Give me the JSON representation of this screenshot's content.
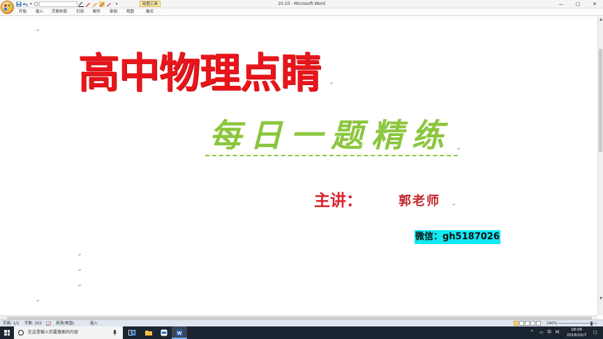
{
  "window": {
    "title": "10.10 - Microsoft Word",
    "contextual_tab": "绘图工具",
    "controls": {
      "minimize": "—",
      "restore": "▢",
      "close": "✕"
    }
  },
  "quick_access": {
    "undo_arrow": "▾",
    "customize": "▾"
  },
  "ribbon": {
    "tabs": [
      "开始",
      "插入",
      "页面布局",
      "引用",
      "邮件",
      "审阅",
      "视图",
      "格式"
    ]
  },
  "document": {
    "main_title": "高中物理点睛",
    "subtitle": "每日一题精练",
    "lecturer_label": "主讲：",
    "lecturer_name": "郭老师",
    "wechat": "微信：gh5187026",
    "paragraph_mark": "↵"
  },
  "status_bar": {
    "page": "页面: 1/1",
    "words": "字数: 202",
    "language": "英语(美国)",
    "mode": "插入",
    "zoom": "240%"
  },
  "taskbar": {
    "search_placeholder": "在这里输入你要搜索的内容",
    "time": "18:08",
    "date": "2018/10/7",
    "tray_ime": "中",
    "tray_mail": "M"
  },
  "colors": {
    "title_red": "#e8151b",
    "subtitle_green": "#8cc63f",
    "lecturer_red": "#d8232a",
    "highlight_cyan": "#11e8f2"
  }
}
